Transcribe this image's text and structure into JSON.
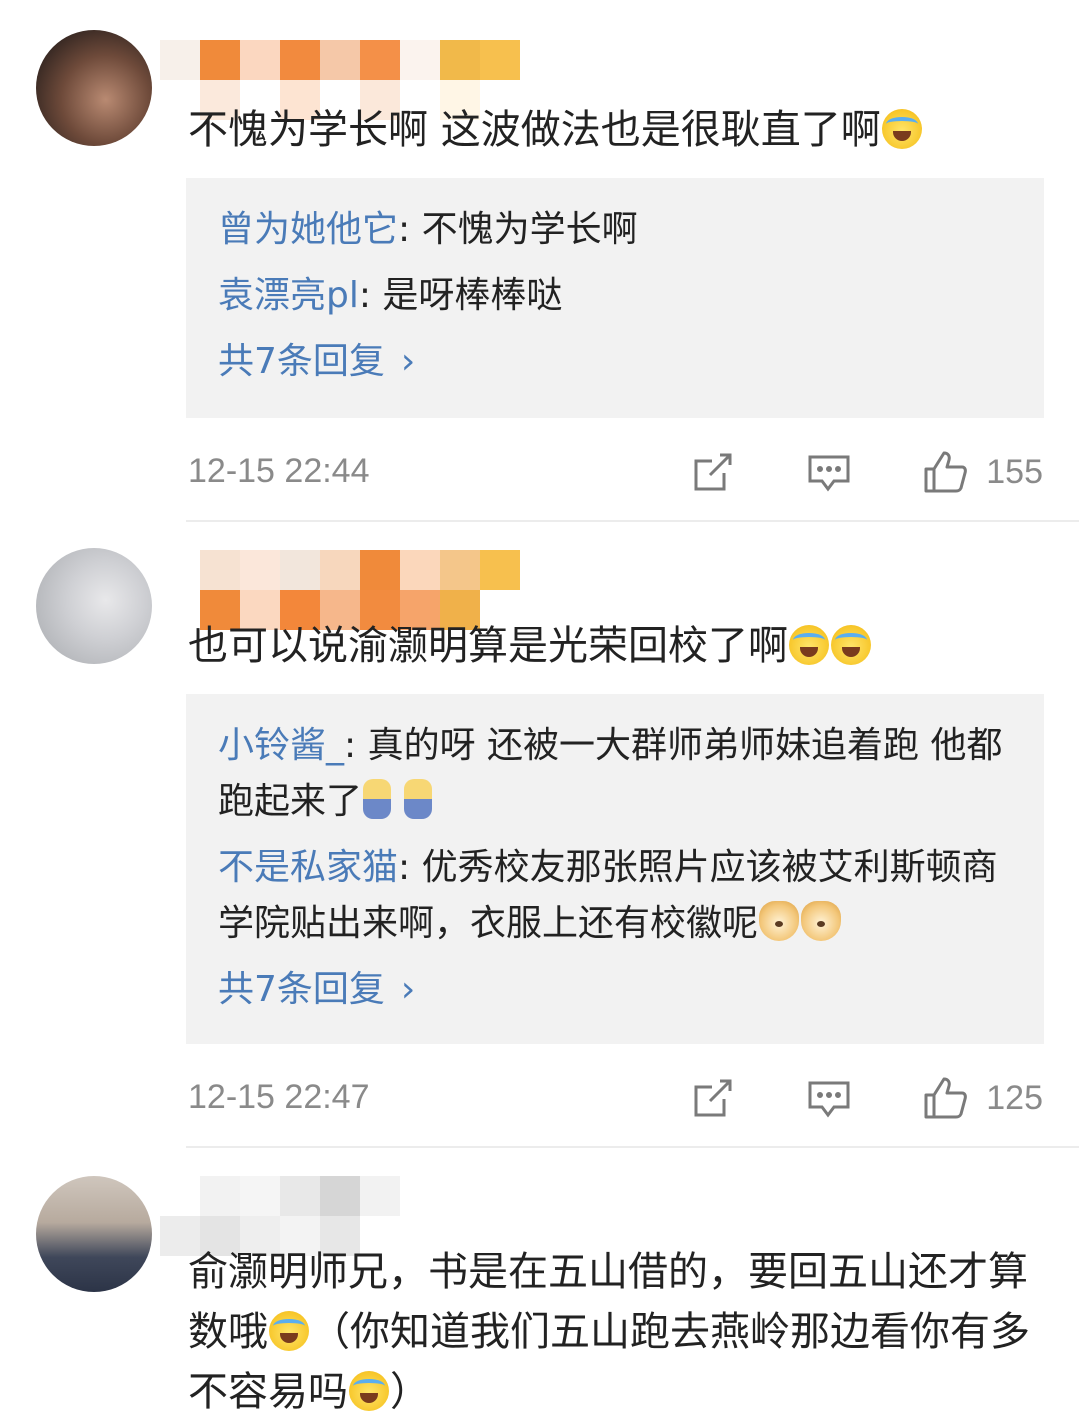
{
  "comments": [
    {
      "text": "不愧为学长啊  这波做法也是很耿直了啊",
      "replies": [
        {
          "user": "曾为她他它",
          "text": ": 不愧为学长啊"
        },
        {
          "user": "袁漂亮pl",
          "text": ": 是呀棒棒哒"
        }
      ],
      "more": "共7条回复",
      "time": "12-15 22:44",
      "likes": "155"
    },
    {
      "text": "也可以说渝灏明算是光荣回校了啊",
      "replies": [
        {
          "user": "小铃酱_",
          "text": ": 真的呀 还被一大群师弟师妹追着跑 他都跑起来了"
        },
        {
          "user": "不是私家猫",
          "text": ": 优秀校友那张照片应该被艾利斯顿商学院贴出来啊，衣服上还有校徽呢"
        }
      ],
      "more": "共7条回复",
      "time": "12-15 22:47",
      "likes": "125"
    },
    {
      "text_a": "俞灏明师兄，书是在五山借的，要回五山还才算数哦",
      "text_b": "（你知道我们五山跑去燕岭那边看你有多不容易吗",
      "text_c": "）"
    }
  ],
  "icons": [
    "share-icon",
    "comment-icon",
    "like-icon",
    "crying-laugh-emoji",
    "doge-emoji",
    "kid-emoji"
  ],
  "colors": {
    "link": "#4a7bb8",
    "meta": "#8a8a8a",
    "reply_bg": "#f2f2f2"
  }
}
